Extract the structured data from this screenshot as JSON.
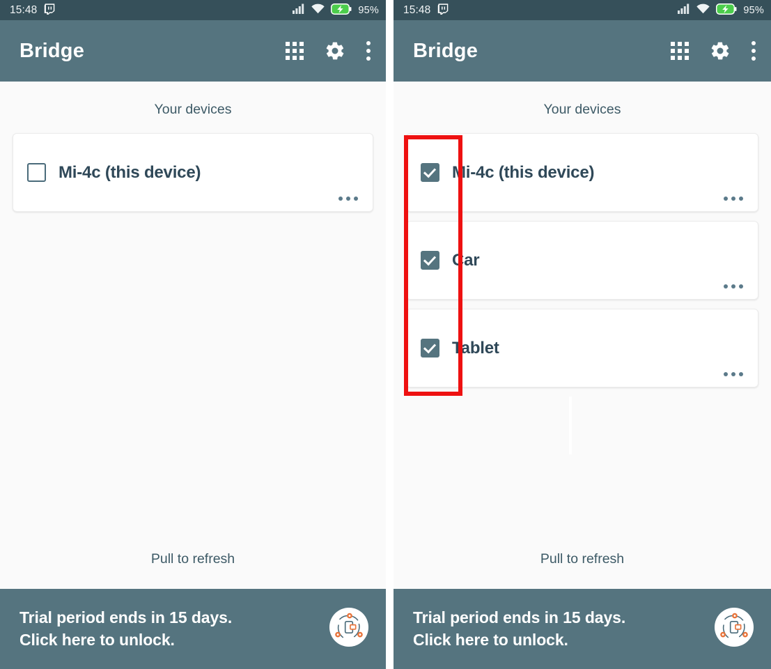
{
  "status_bar": {
    "clock": "15:48",
    "notification_icon": "twitch-icon",
    "signal_icon": "cellular-signal-icon",
    "wifi_icon": "wifi-icon",
    "battery_icon": "battery-charging-icon",
    "battery_percent": "95%",
    "background_color": "#36505a"
  },
  "toolbar": {
    "title": "Bridge",
    "apps_grid_label": "apps-grid",
    "settings_label": "settings",
    "overflow_label": "more-options",
    "background_color": "#55747f"
  },
  "content": {
    "section_title": "Your devices",
    "pull_to_refresh": "Pull to refresh",
    "background_color": "#fafafa"
  },
  "banner": {
    "line1": "Trial period ends in 15 days.",
    "line2": "Click here to unlock.",
    "background_color": "#55747f",
    "logo_icon": "bridge-app-logo-icon",
    "logo_accent_color": "#e8743b"
  },
  "panels": [
    {
      "name": "before",
      "devices": [
        {
          "label": "Mi-4c (this device)",
          "checked": false,
          "more_icon": "more-horizontal-icon"
        }
      ]
    },
    {
      "name": "after",
      "devices": [
        {
          "label": "Mi-4c (this device)",
          "checked": true,
          "more_icon": "more-horizontal-icon"
        },
        {
          "label": "Car",
          "checked": true,
          "more_icon": "more-horizontal-icon"
        },
        {
          "label": "Tablet",
          "checked": true,
          "more_icon": "more-horizontal-icon"
        }
      ]
    }
  ],
  "annotation": {
    "color": "#ee1111",
    "target": "device-checkbox-column"
  }
}
